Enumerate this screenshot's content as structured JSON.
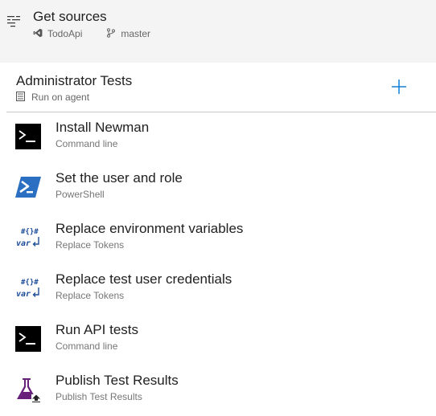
{
  "sources": {
    "title": "Get sources",
    "repo": "TodoApi",
    "branch": "master",
    "icon": "list-icon",
    "repo_icon": "visual-studio-icon",
    "branch_icon": "branch-icon"
  },
  "phase": {
    "title": "Administrator Tests",
    "subtitle": "Run on agent",
    "subtitle_icon": "server-icon",
    "add_icon": "plus-icon"
  },
  "tasks": [
    {
      "name": "Install Newman",
      "type": "Command line",
      "icon": "command-line-icon"
    },
    {
      "name": "Set the user and role",
      "type": "PowerShell",
      "icon": "powershell-icon"
    },
    {
      "name": "Replace environment variables",
      "type": "Replace Tokens",
      "icon": "replace-tokens-icon"
    },
    {
      "name": "Replace test user credentials",
      "type": "Replace Tokens",
      "icon": "replace-tokens-icon"
    },
    {
      "name": "Run API tests",
      "type": "Command line",
      "icon": "command-line-icon"
    },
    {
      "name": "Publish Test Results",
      "type": "Publish Test Results",
      "icon": "publish-test-results-icon"
    }
  ],
  "colors": {
    "accent": "#0078d4",
    "top_background": "#f4f4f4",
    "powershell_blue": "#2b6fc2",
    "publish_purple": "#68217a",
    "tokens_blue": "#1e4e9a"
  }
}
